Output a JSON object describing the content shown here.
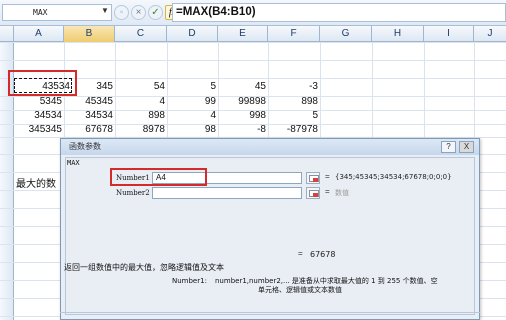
{
  "formula_bar": {
    "name_box": "MAX",
    "cancel_symbol": "×",
    "enter_symbol": "✓",
    "fx_symbol": "fx",
    "formula": "=MAX(B4:B10)"
  },
  "columns": [
    "A",
    "B",
    "C",
    "D",
    "E",
    "F",
    "G",
    "H",
    "I",
    "J"
  ],
  "cells": {
    "r4": [
      "43534",
      "345",
      "54",
      "5",
      "45",
      "-3"
    ],
    "r5": [
      "5345",
      "45345",
      "4",
      "99",
      "99898",
      "898"
    ],
    "r6": [
      "34534",
      "34534",
      "898",
      "4",
      "998",
      "5"
    ],
    "r7": [
      "345345",
      "67678",
      "8978",
      "98",
      "-8",
      "-87978"
    ],
    "side_label": "最大的数"
  },
  "dialog": {
    "title": "函数参数",
    "help_btn": "?",
    "close_btn": "X",
    "function_name": "MAX",
    "args": [
      {
        "label": "Number1",
        "value": "A4",
        "equals": "=",
        "result": "{345;45345;34534;67678;0;0;0}"
      },
      {
        "label": "Number2",
        "value": "",
        "equals": "=",
        "result": "数值"
      }
    ],
    "total_equals": "=",
    "total_result": "67678",
    "description": "返回一组数值中的最大值，忽略逻辑值及文本",
    "arg_help_label": "Number1:",
    "arg_help_text_1": "number1,number2,...  是准备从中求取最大值的 1 到 255 个数值、空",
    "arg_help_text_2": "单元格、逻辑值或文本数值"
  }
}
